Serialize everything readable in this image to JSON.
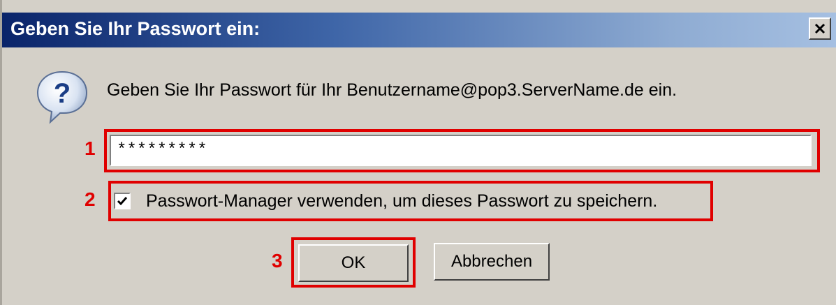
{
  "window": {
    "title": "Geben Sie Ihr Passwort ein:",
    "close_icon": "close-icon"
  },
  "dialog": {
    "icon": "question-icon",
    "message": "Geben Sie Ihr Passwort für Ihr Benutzername@pop3.ServerName.de ein.",
    "password_value": "*********",
    "checkbox_checked": true,
    "checkbox_label": "Passwort-Manager verwenden, um dieses Passwort zu speichern.",
    "ok_label": "OK",
    "cancel_label": "Abbrechen"
  },
  "annotations": {
    "marker_1": "1",
    "marker_2": "2",
    "marker_3": "3",
    "highlight_color": "#e00000"
  }
}
